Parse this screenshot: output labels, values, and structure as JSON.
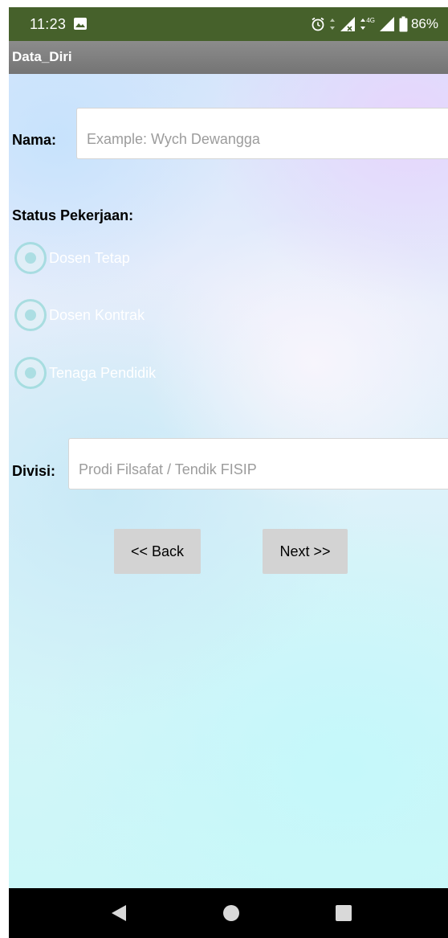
{
  "status_bar": {
    "time": "11:23",
    "network": "4G",
    "battery": "86%",
    "icons": [
      "gallery-icon",
      "alarm-icon",
      "data-arrows-icon",
      "signal-icon",
      "battery-icon"
    ]
  },
  "app": {
    "title": "Data_Diri"
  },
  "form": {
    "nama": {
      "label": "Nama:",
      "value": "",
      "placeholder": "Example: Wych Dewangga"
    },
    "status": {
      "heading": "Status Pekerjaan:",
      "options": [
        {
          "label": "Dosen Tetap",
          "selected": false
        },
        {
          "label": "Dosen Kontrak",
          "selected": false
        },
        {
          "label": "Tenaga Pendidik",
          "selected": false
        }
      ]
    },
    "divisi": {
      "label": "Divisi:",
      "value": "",
      "placeholder": "Prodi Filsafat / Tendik FISIP"
    },
    "buttons": {
      "back": "<< Back",
      "next": "Next >>"
    }
  },
  "navigation_bar": {
    "icons": [
      "nav-back-icon",
      "nav-home-icon",
      "nav-recents-icon"
    ]
  },
  "colors": {
    "status_bar": "#46612b",
    "title_bar": "#808080",
    "button": "#d3d3d3",
    "nav_bar": "#000000"
  }
}
